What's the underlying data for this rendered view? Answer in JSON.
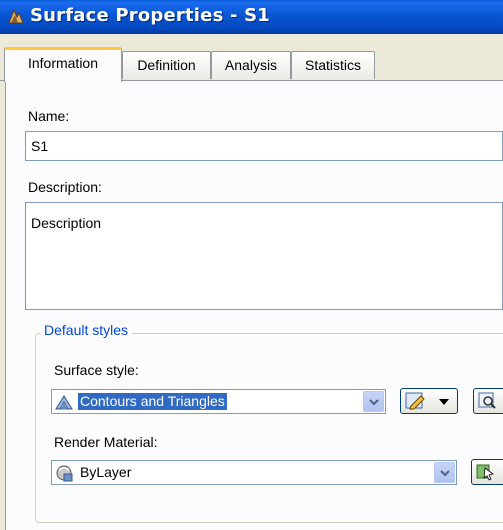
{
  "window": {
    "title": "Surface Properties - S1"
  },
  "tabs": [
    {
      "label": "Information",
      "active": true
    },
    {
      "label": "Definition",
      "active": false
    },
    {
      "label": "Analysis",
      "active": false
    },
    {
      "label": "Statistics",
      "active": false
    }
  ],
  "info": {
    "name_label": "Name:",
    "name_value": "S1",
    "description_label": "Description:",
    "description_value": "Description"
  },
  "default_styles": {
    "group_label": "Default styles",
    "surface_style_label": "Surface style:",
    "surface_style_value": "Contours and Triangles",
    "surface_style_icon": "surface-style-icon",
    "render_material_label": "Render Material:",
    "render_material_value": "ByLayer",
    "render_material_icon": "render-material-icon"
  },
  "colors": {
    "titlebar": "#0449c2",
    "active_tab_accent": "#ffc73c",
    "group_title": "#0046d5",
    "selection": "#316ac5"
  }
}
